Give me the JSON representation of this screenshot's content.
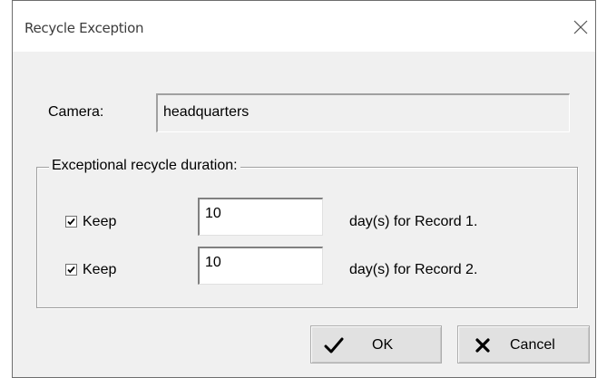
{
  "window": {
    "title": "Recycle Exception"
  },
  "camera": {
    "label": "Camera:",
    "value": "headquarters"
  },
  "group": {
    "legend": "Exceptional recycle duration:"
  },
  "rows": [
    {
      "keep_label": "Keep",
      "checked": true,
      "days": "10",
      "suffix": "day(s) for Record 1."
    },
    {
      "keep_label": "Keep",
      "checked": true,
      "days": "10",
      "suffix": "day(s) for Record 2."
    }
  ],
  "buttons": {
    "ok_label": "OK",
    "cancel_label": "Cancel"
  },
  "icons": {
    "close": "close-icon",
    "ok": "checkmark-icon",
    "cancel": "x-mark-icon",
    "checkbox": "checkmark-icon"
  }
}
